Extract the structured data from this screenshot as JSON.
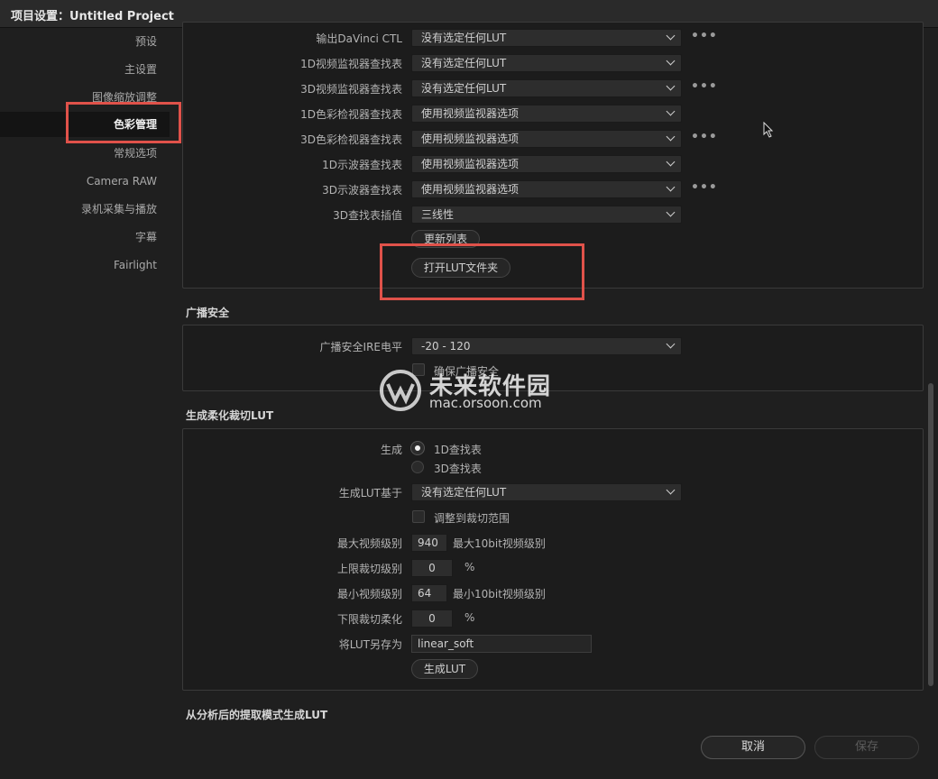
{
  "window": {
    "title": "项目设置：Untitled Project"
  },
  "sidebar": {
    "items": [
      {
        "label": "预设"
      },
      {
        "label": "主设置"
      },
      {
        "label": "图像缩放调整"
      },
      {
        "label": "色彩管理"
      },
      {
        "label": "常规选项"
      },
      {
        "label": "Camera RAW"
      },
      {
        "label": "录机采集与播放"
      },
      {
        "label": "字幕"
      },
      {
        "label": "Fairlight"
      }
    ],
    "active_index": 3
  },
  "lut_section": {
    "rows": [
      {
        "label": "输出DaVinci CTL",
        "value": "没有选定任何LUT"
      },
      {
        "label": "1D视频监视器查找表",
        "value": "没有选定任何LUT"
      },
      {
        "label": "3D视频监视器查找表",
        "value": "没有选定任何LUT"
      },
      {
        "label": "1D色彩检视器查找表",
        "value": "使用视频监视器选项"
      },
      {
        "label": "3D色彩检视器查找表",
        "value": "使用视频监视器选项"
      },
      {
        "label": "1D示波器查找表",
        "value": "使用视频监视器选项"
      },
      {
        "label": "3D示波器查找表",
        "value": "使用视频监视器选项"
      },
      {
        "label": "3D查找表插值",
        "value": "三线性"
      }
    ],
    "more_label": "•••",
    "update_list_button": "更新列表",
    "open_lut_folder_button": "打开LUT文件夹"
  },
  "broadcast_safe": {
    "title": "广播安全",
    "ire_label": "广播安全IRE电平",
    "ire_value": "-20 - 120",
    "ensure_label": "确保广播安全"
  },
  "soft_clip": {
    "title": "生成柔化裁切LUT",
    "generate_label": "生成",
    "option_1d": "1D查找表",
    "option_3d": "3D查找表",
    "based_on_label": "生成LUT基于",
    "based_on_value": "没有选定任何LUT",
    "adjust_label": "调整到裁切范围",
    "max_video_label": "最大视频级别",
    "max_video_value": "940",
    "max_video_hint": "最大10bit视频级别",
    "upper_clip_label": "上限裁切级别",
    "upper_clip_value": "0",
    "min_video_label": "最小视频级别",
    "min_video_value": "64",
    "min_video_hint": "最小10bit视频级别",
    "lower_clip_label": "下限裁切柔化",
    "lower_clip_value": "0",
    "percent": "%",
    "save_as_label": "将LUT另存为",
    "save_as_value": "linear_soft",
    "generate_button": "生成LUT"
  },
  "analysis": {
    "title": "从分析后的提取模式生成LUT"
  },
  "footer": {
    "cancel": "取消",
    "save": "保存"
  },
  "watermark": {
    "name": "未来软件园",
    "url": "mac.orsoon.com"
  },
  "colors": {
    "highlight_box": "#e0524a",
    "background": "#1f1f1f"
  }
}
